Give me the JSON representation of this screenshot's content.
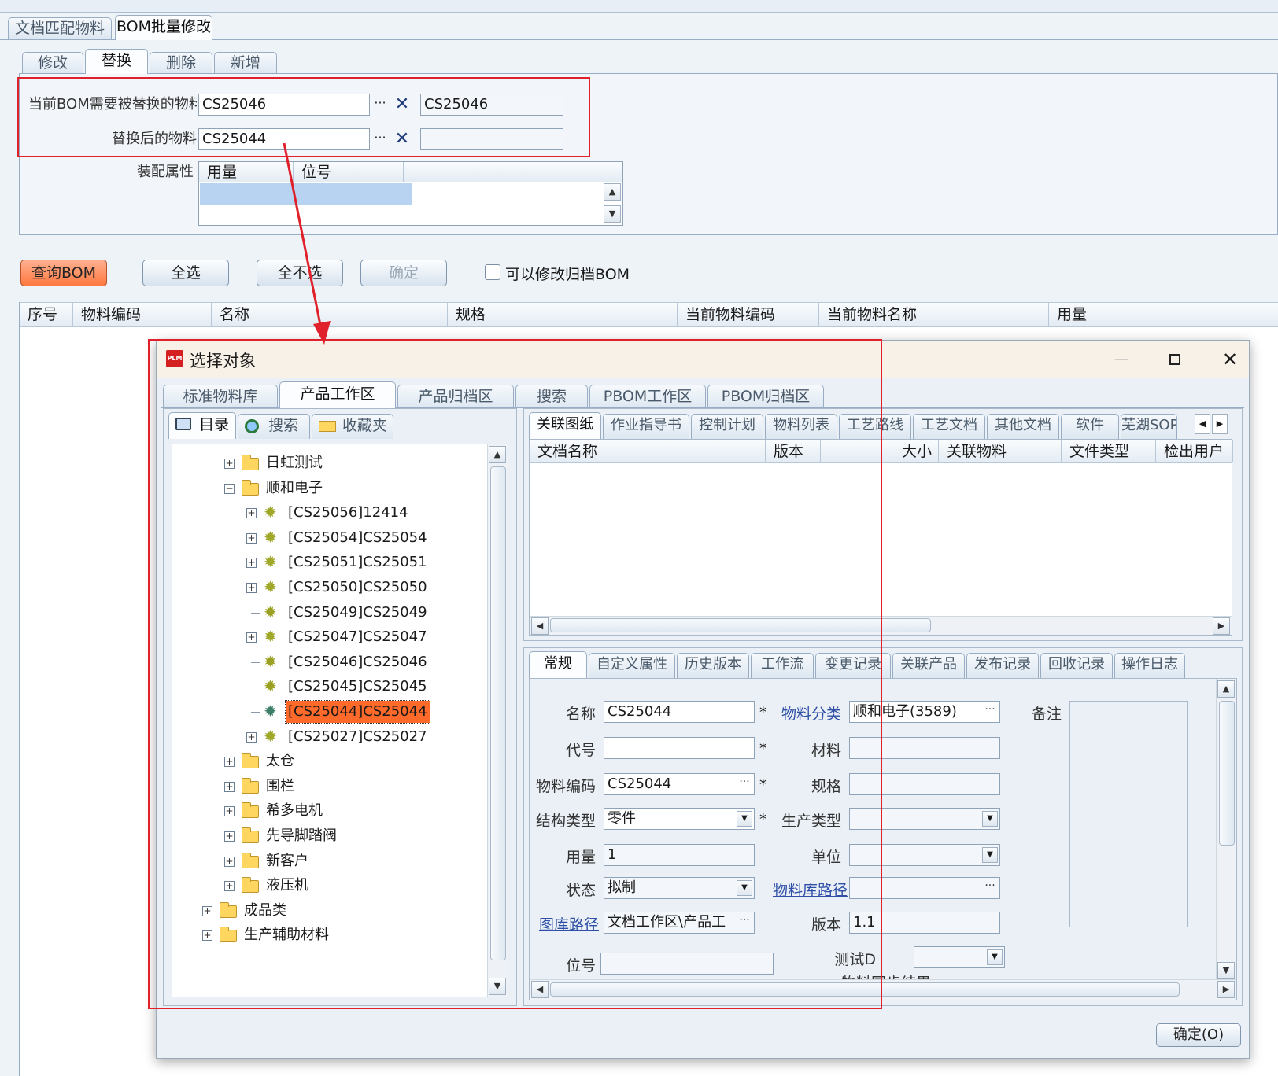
{
  "outer_tabs": [
    "文档匹配物料",
    "BOM批量修改"
  ],
  "sub_tabs": [
    "修改",
    "替换",
    "删除",
    "新增"
  ],
  "form": {
    "replaced_label": "当前BOM需要被替换的物料",
    "replaced_value": "CS25046",
    "replaced_display": "CS25046",
    "replacement_label": "替换后的物料",
    "replacement_value": "CS25044",
    "replacement_display": "",
    "assembly_label": "装配属性",
    "assembly_columns": [
      "用量",
      "位号"
    ]
  },
  "toolbar": {
    "query": "查询BOM",
    "select_all": "全选",
    "select_none": "全不选",
    "confirm": "确定",
    "allow_archive": "可以修改归档BOM",
    "allow_archive_checked": false
  },
  "result_columns": [
    "序号",
    "物料编码",
    "名称",
    "规格",
    "当前物料编码",
    "当前物料名称",
    "用量"
  ],
  "dialog": {
    "logo": "PLM",
    "title": "选择对象",
    "tabs": [
      "标准物料库",
      "产品工作区",
      "产品归档区",
      "搜索",
      "PBOM工作区",
      "PBOM归档区"
    ],
    "left_tabs": [
      "目录",
      "搜索",
      "收藏夹"
    ],
    "tree": [
      {
        "label": "日虹测试",
        "type": "folder",
        "level": 1,
        "toggle": "+"
      },
      {
        "label": "顺和电子",
        "type": "folder",
        "level": 1,
        "toggle": "-"
      },
      {
        "label": "[CS25056]12414",
        "type": "part",
        "level": 2,
        "toggle": "+"
      },
      {
        "label": "[CS25054]CS25054",
        "type": "part",
        "level": 2,
        "toggle": "+"
      },
      {
        "label": "[CS25051]CS25051",
        "type": "part",
        "level": 2,
        "toggle": "+"
      },
      {
        "label": "[CS25050]CS25050",
        "type": "part",
        "level": 2,
        "toggle": "+"
      },
      {
        "label": "[CS25049]CS25049",
        "type": "leaf",
        "level": 2,
        "toggle": ""
      },
      {
        "label": "[CS25047]CS25047",
        "type": "part",
        "level": 2,
        "toggle": "+"
      },
      {
        "label": "[CS25046]CS25046",
        "type": "leaf",
        "level": 2,
        "toggle": ""
      },
      {
        "label": "[CS25045]CS25045",
        "type": "leaf",
        "level": 2,
        "toggle": ""
      },
      {
        "label": "[CS25044]CS25044",
        "type": "selected",
        "level": 2,
        "toggle": ""
      },
      {
        "label": "[CS25027]CS25027",
        "type": "part",
        "level": 2,
        "toggle": "+"
      },
      {
        "label": "太仓",
        "type": "folder",
        "level": 1,
        "toggle": "+"
      },
      {
        "label": "围栏",
        "type": "folder",
        "level": 1,
        "toggle": "+"
      },
      {
        "label": "希多电机",
        "type": "folder",
        "level": 1,
        "toggle": "+"
      },
      {
        "label": "先导脚踏阀",
        "type": "folder",
        "level": 1,
        "toggle": "+"
      },
      {
        "label": "新客户",
        "type": "folder",
        "level": 1,
        "toggle": "+"
      },
      {
        "label": "液压机",
        "type": "folder",
        "level": 1,
        "toggle": "+"
      },
      {
        "label": "成品类",
        "type": "folder",
        "level": 0,
        "toggle": "+"
      },
      {
        "label": "生产辅助材料",
        "type": "folder",
        "level": 0,
        "toggle": "+"
      }
    ],
    "doc_tabs": [
      "关联图纸",
      "作业指导书",
      "控制计划",
      "物料列表",
      "工艺路线",
      "工艺文档",
      "其他文档",
      "软件",
      "芜湖SOP"
    ],
    "doc_columns": [
      "文档名称",
      "版本",
      "大小",
      "关联物料",
      "文件类型",
      "检出用户"
    ],
    "detail_tabs": [
      "常规",
      "自定义属性",
      "历史版本",
      "工作流",
      "变更记录",
      "关联产品",
      "发布记录",
      "回收记录",
      "操作日志"
    ],
    "detail": {
      "name_label": "名称",
      "name_value": "CS25044",
      "category_label": "物料分类",
      "category_value": "顺和电子(3589)",
      "remark_label": "备注",
      "code_label": "代号",
      "code_value": "",
      "material_label": "材料",
      "material_value": "",
      "part_no_label": "物料编码",
      "part_no_value": "CS25044",
      "spec_label": "规格",
      "spec_value": "",
      "struct_label": "结构类型",
      "struct_value": "零件",
      "prod_type_label": "生产类型",
      "prod_type_value": "",
      "qty_label": "用量",
      "qty_value": "1",
      "unit_label": "单位",
      "unit_value": "",
      "state_label": "状态",
      "state_value": "拟制",
      "lib_path_label": "物料库路径",
      "lib_path_value": "",
      "doc_path_label": "图库路径",
      "doc_path_value": "文档工作区\\产品工",
      "version_label": "版本",
      "version_value": "1.1",
      "position_label": "位号",
      "position_value": "",
      "test_label": "测试D",
      "test_value": "",
      "sync_label": "物料同步结果",
      "required_mark": "*"
    },
    "ok_button": "确定(O)"
  },
  "colors": {
    "accent_red": "#e0202a",
    "selected_bg": "#ff6a2a",
    "selection_row": "#b8d3f2",
    "orange_btn": "#ff8a55"
  }
}
